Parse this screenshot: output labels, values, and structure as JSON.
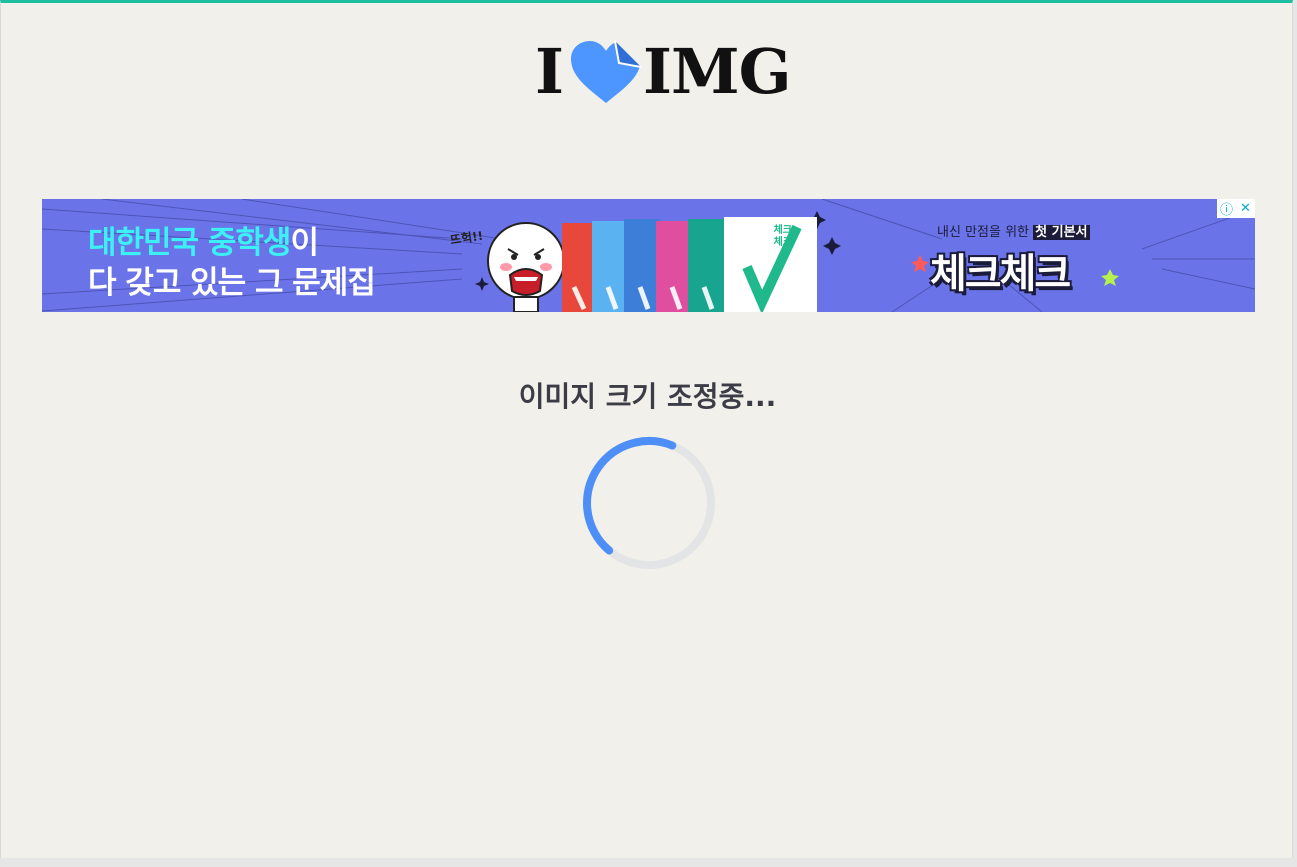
{
  "logo": {
    "prefix": "I",
    "suffix": "IMG"
  },
  "ad": {
    "headline_highlight": "대한민국 중학생",
    "headline_rest": "이",
    "subline": "다 갖고 있는 그 문제집",
    "shout": "뜨헉!!",
    "tagline_pre": "내신 만점을 위한 ",
    "tagline_tag": "첫 기본서",
    "brand": "체크체크",
    "book_title": "체크\n체크",
    "info_icon": "ⓘ",
    "close_icon": "✕",
    "colors": {
      "background": "#6a74e8",
      "highlight": "#3df0f5"
    }
  },
  "status": {
    "message": "이미지 크기 조정중..."
  },
  "spinner": {
    "progress": 0.45,
    "track_color": "#e3e4e5",
    "arc_color": "#4d8ff7"
  },
  "colors": {
    "top_border": "#1dbfa0",
    "page_bg": "#f2f0eb",
    "logo_heart": "#4d96ff"
  }
}
